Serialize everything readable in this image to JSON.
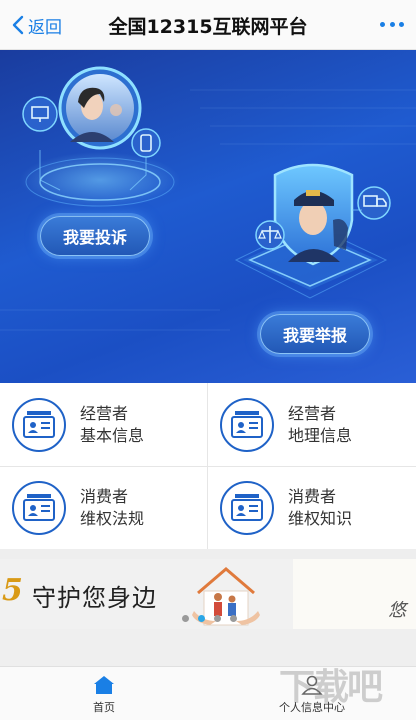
{
  "navbar": {
    "back_label": "返回",
    "title": "全国12315互联网平台"
  },
  "banner": {
    "complaint_button": "我要投诉",
    "report_button": "我要举报"
  },
  "grid": {
    "items": [
      {
        "line1": "经营者",
        "line2": "基本信息"
      },
      {
        "line1": "经营者",
        "line2": "地理信息"
      },
      {
        "line1": "消费者",
        "line2": "维权法规"
      },
      {
        "line1": "消费者",
        "line2": "维权知识"
      }
    ]
  },
  "promo": {
    "number": "5",
    "text": "守护您身边",
    "signature": "悠",
    "active_dot": 2,
    "dot_count": 4
  },
  "tabbar": {
    "home_label": "首页",
    "profile_label": "个人信息中心"
  },
  "watermark": "下载吧",
  "colors": {
    "accent": "#1a7fe5",
    "banner_blue": "#1f5bd0",
    "icon_blue": "#1f62c7",
    "promo_orange": "#d99a16"
  }
}
